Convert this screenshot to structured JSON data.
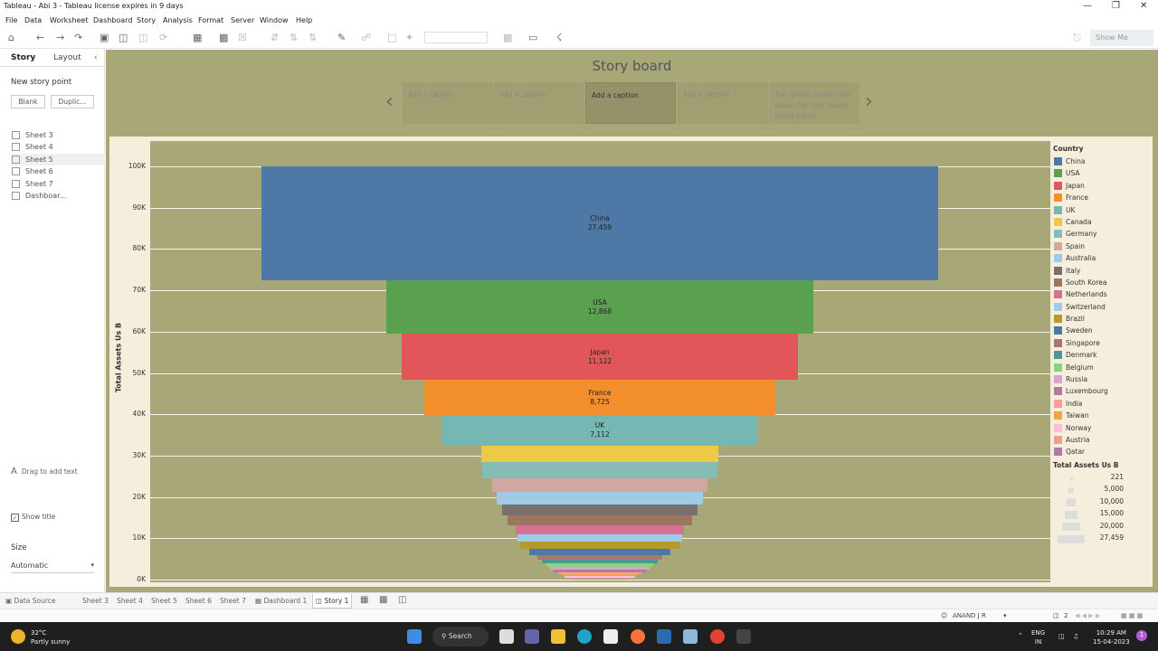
{
  "window": {
    "title": "Tableau - Abi 3 - Tableau license expires in 9 days"
  },
  "menu": [
    "File",
    "Data",
    "Worksheet",
    "Dashboard",
    "Story",
    "Analysis",
    "Format",
    "Server",
    "Window",
    "Help"
  ],
  "toolbar": {
    "show_me": "Show Me"
  },
  "left_pane": {
    "tabs": {
      "story": "Story",
      "layout": "Layout"
    },
    "new_story_point": "New story point",
    "blank": "Blank",
    "duplicate": "Duplic...",
    "sheets": [
      "Sheet 3",
      "Sheet 4",
      "Sheet 5",
      "Sheet 6",
      "Sheet 7",
      "Dashboar..."
    ],
    "drag_text": "Drag to add text",
    "show_title": "Show title",
    "size_label": "Size",
    "size_value": "Automatic"
  },
  "story": {
    "title": "Story board",
    "captions": [
      "Add a caption",
      "Add a caption",
      "Add a caption",
      "Add a caption",
      "This graph explain me about the total assets of the banks"
    ]
  },
  "chart_data": {
    "type": "bar",
    "subtype": "funnel",
    "ylabel": "Total Assets Us B",
    "y_ticks": [
      "100K",
      "90K",
      "80K",
      "70K",
      "60K",
      "50K",
      "40K",
      "30K",
      "20K",
      "10K",
      "0K"
    ],
    "ylim": [
      0,
      100000
    ],
    "legend_title": "Country",
    "categories": [
      "China",
      "USA",
      "Japan",
      "France",
      "UK",
      "Canada",
      "Germany",
      "Spain",
      "Australia",
      "Italy",
      "South Korea",
      "Netherlands",
      "Switzerland",
      "Brazil",
      "Sweden",
      "Singapore",
      "Denmark",
      "Belgium",
      "Russia",
      "Luxembourg",
      "India",
      "Taiwan",
      "Norway",
      "Austria",
      "Qatar"
    ],
    "values": [
      27459,
      12868,
      11122,
      8725,
      7112,
      4000,
      3900,
      3300,
      3000,
      2700,
      2400,
      2000,
      1900,
      1800,
      1400,
      1100,
      950,
      800,
      700,
      600,
      500,
      400,
      350,
      280,
      221
    ],
    "bar_labels": [
      {
        "country": "China",
        "value": "27,459"
      },
      {
        "country": "USA",
        "value": "12,868"
      },
      {
        "country": "Japan",
        "value": "11,122"
      },
      {
        "country": "France",
        "value": "8,725"
      },
      {
        "country": "UK",
        "value": "7,112"
      }
    ],
    "colors": [
      "#4e79a7",
      "#59a14f",
      "#e15759",
      "#f28e2b",
      "#76b7b2",
      "#edc948",
      "#86bcb6",
      "#d4a6a0",
      "#a0cbe8",
      "#79706e",
      "#9d7660",
      "#d37295",
      "#a0cbe8",
      "#b6992d",
      "#4e79a7",
      "#a8786e",
      "#499894",
      "#8cd17d",
      "#d4a6c8",
      "#b07aa1",
      "#ff9d9a",
      "#f1a340",
      "#fabfd2",
      "#e8a18a",
      "#b07aa1"
    ],
    "size_legend_title": "Total Assets Us B",
    "size_legend": [
      "221",
      "5,000",
      "10,000",
      "15,000",
      "20,000",
      "27,459"
    ]
  },
  "bottom_tabs": [
    "Data Source",
    "Sheet 3",
    "Sheet 4",
    "Sheet 5",
    "Sheet 6",
    "Sheet 7",
    "Dashboard 1",
    "Story 1"
  ],
  "status": {
    "user": "ANAND J R",
    "pages": "2"
  },
  "taskbar": {
    "temp": "32°C",
    "weather": "Partly sunny",
    "search": "Search",
    "lang1": "ENG",
    "lang2": "IN",
    "time": "10:29 AM",
    "date": "15-04-2023",
    "notif": "1"
  }
}
